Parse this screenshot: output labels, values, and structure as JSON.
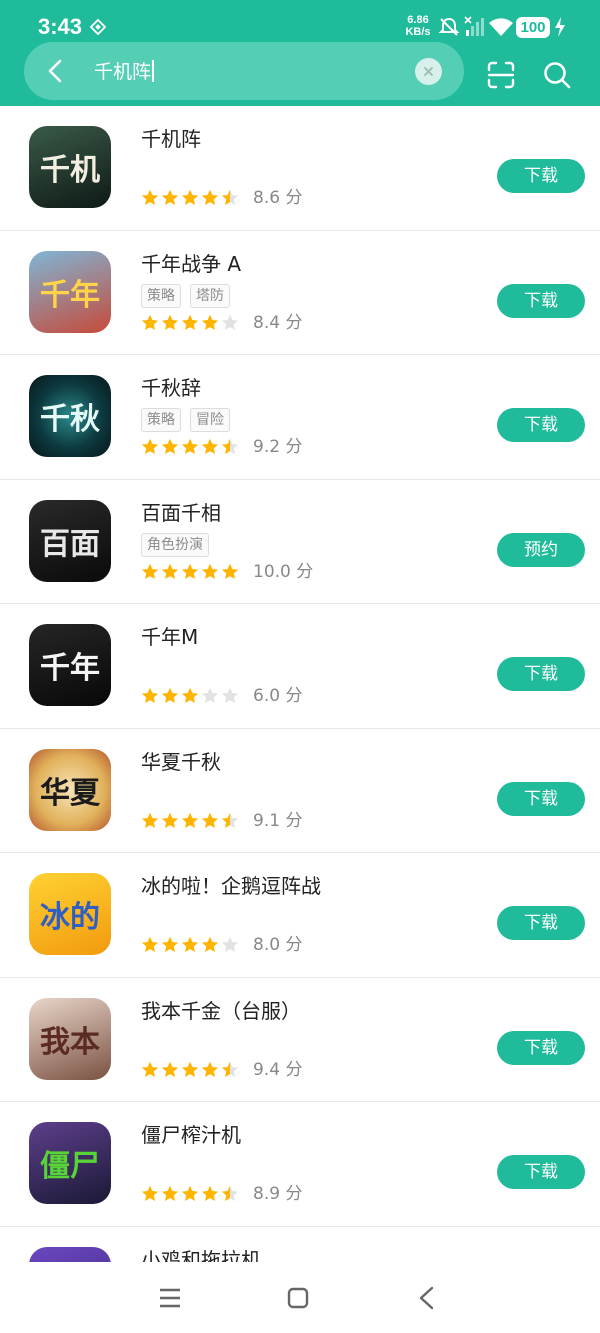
{
  "status_bar": {
    "time": "3:43",
    "net_speed_value": "6.86",
    "net_speed_unit": "KB/s",
    "battery": "100"
  },
  "search": {
    "query": "千机阵"
  },
  "colors": {
    "accent": "#1fbb9b",
    "star": "#ffb400",
    "star_empty": "#e2e2e2"
  },
  "apps": [
    {
      "title": "千机阵",
      "tags": [],
      "stars": 4.5,
      "score": "8.6 分",
      "button": "下载",
      "icon": {
        "bg": "linear-gradient(160deg,#3a5a48,#0e1a16)",
        "color": "#f3efe0"
      }
    },
    {
      "title": "千年战争 A",
      "tags": [
        "策略",
        "塔防"
      ],
      "stars": 4,
      "score": "8.4 分",
      "button": "下载",
      "icon": {
        "bg": "linear-gradient(160deg,#7fb6d6,#c64a3a)",
        "color": "#ffd34a"
      }
    },
    {
      "title": "千秋辞",
      "tags": [
        "策略",
        "冒险"
      ],
      "stars": 4.5,
      "score": "9.2 分",
      "button": "下载",
      "icon": {
        "bg": "radial-gradient(circle,#2a8a8c 0%,#0d3a40 55%,#07161a 100%)",
        "color": "#e6fbf7"
      }
    },
    {
      "title": "百面千相",
      "tags": [
        "角色扮演"
      ],
      "stars": 5,
      "score": "10.0 分",
      "button": "预约",
      "icon": {
        "bg": "linear-gradient(160deg,#2a2a2a,#0a0a0a)",
        "color": "#e8e8e8"
      }
    },
    {
      "title": "千年M",
      "tags": [],
      "stars": 3,
      "score": "6.0 分",
      "button": "下载",
      "icon": {
        "bg": "linear-gradient(160deg,#262626,#080808)",
        "color": "#f5f5f5"
      }
    },
    {
      "title": "华夏千秋",
      "tags": [],
      "stars": 4.5,
      "score": "9.1 分",
      "button": "下载",
      "icon": {
        "bg": "radial-gradient(circle,#f6e3b8 0%,#e1b15a 60%,#b5542e 100%)",
        "color": "#1b1b1b"
      }
    },
    {
      "title": "冰的啦！企鹅逗阵战",
      "tags": [],
      "stars": 4,
      "score": "8.0 分",
      "button": "下载",
      "icon": {
        "bg": "linear-gradient(160deg,#ffd233,#f29a0e)",
        "color": "#2f5fc2"
      }
    },
    {
      "title": "我本千金（台服）",
      "tags": [],
      "stars": 4.5,
      "score": "9.4 分",
      "button": "下载",
      "icon": {
        "bg": "linear-gradient(160deg,#e9d6c9,#7a5243)",
        "color": "#5b2b22"
      }
    },
    {
      "title": "僵尸榨汁机",
      "tags": [],
      "stars": 4.5,
      "score": "8.9 分",
      "button": "下载",
      "icon": {
        "bg": "linear-gradient(160deg,#5d3f8c,#1b1935)",
        "color": "#58d338"
      }
    },
    {
      "title": "小鸡和拖拉机",
      "tags": [],
      "stars": 0,
      "score": "",
      "button": "",
      "icon": {
        "bg": "linear-gradient(160deg,#6b47c2,#3c2a7a)",
        "color": "#ffffff"
      }
    }
  ]
}
